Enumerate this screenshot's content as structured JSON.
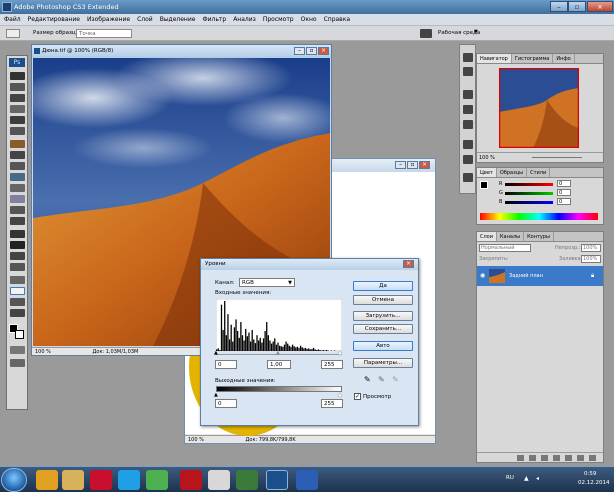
{
  "app": {
    "title": "Adobe Photoshop CS3 Extended"
  },
  "menu": [
    "Файл",
    "Редактирование",
    "Изображение",
    "Слой",
    "Выделение",
    "Фильтр",
    "Анализ",
    "Просмотр",
    "Окно",
    "Справка"
  ],
  "options": {
    "size_label": "Размер образца:",
    "size_value": "Точка",
    "workspace": "Рабочая среда"
  },
  "doc1": {
    "title": "Дюна.tif @ 100% (RGB/8)",
    "zoom": "100 %",
    "info": "Док: 1,03M/1,03M"
  },
  "doc2": {
    "zoom": "100 %",
    "info": "Док: 799,8K/799,8K"
  },
  "levels": {
    "title": "Уровни",
    "channel_label": "Канал:",
    "channel_value": "RGB",
    "input_label": "Входные значения:",
    "input_black": "0",
    "input_gamma": "1,00",
    "input_white": "255",
    "output_label": "Выходные значения:",
    "output_black": "0",
    "output_white": "255",
    "buttons": {
      "ok": "Да",
      "cancel": "Отмена",
      "load": "Загрузить...",
      "save": "Сохранить...",
      "auto": "Авто",
      "options": "Параметры..."
    },
    "preview_label": "Просмотр",
    "preview_checked": true,
    "histogram": [
      3,
      5,
      2,
      88,
      40,
      95,
      30,
      70,
      22,
      50,
      18,
      45,
      60,
      38,
      25,
      55,
      30,
      20,
      42,
      28,
      35,
      18,
      40,
      22,
      15,
      30,
      20,
      25,
      16,
      24,
      38,
      55,
      30,
      20,
      14,
      18,
      24,
      12,
      16,
      10,
      9,
      8,
      12,
      18,
      14,
      10,
      8,
      12,
      9,
      7,
      8,
      6,
      10,
      7,
      5,
      6,
      4,
      5,
      3,
      4,
      6,
      3,
      2,
      3,
      2,
      1,
      2,
      1,
      2,
      1,
      0,
      1,
      0,
      1,
      0,
      0,
      0,
      0
    ]
  },
  "navigator": {
    "tabs": [
      "Навигатор",
      "Гистограмма",
      "Инфо"
    ],
    "zoom": "100 %"
  },
  "color_panel": {
    "tabs": [
      "Цвет",
      "Образцы",
      "Стили"
    ],
    "r_label": "R",
    "g_label": "G",
    "b_label": "B",
    "r_val": "0",
    "g_val": "0",
    "b_val": "0"
  },
  "layers": {
    "tabs": [
      "Слои",
      "Каналы",
      "Контуры"
    ],
    "blend": "Нормальный",
    "opacity_label": "Непрозр.:",
    "opacity": "100%",
    "lock_label": "Закрепить:",
    "fill_label": "Заливка:",
    "fill": "100%",
    "layer_name": "Задний план"
  },
  "tray": {
    "lang": "RU",
    "time": "0:59",
    "date": "02.12.2014"
  },
  "colors": {
    "accent": "#3a7ac9",
    "desktop": "#9a9a9a"
  }
}
